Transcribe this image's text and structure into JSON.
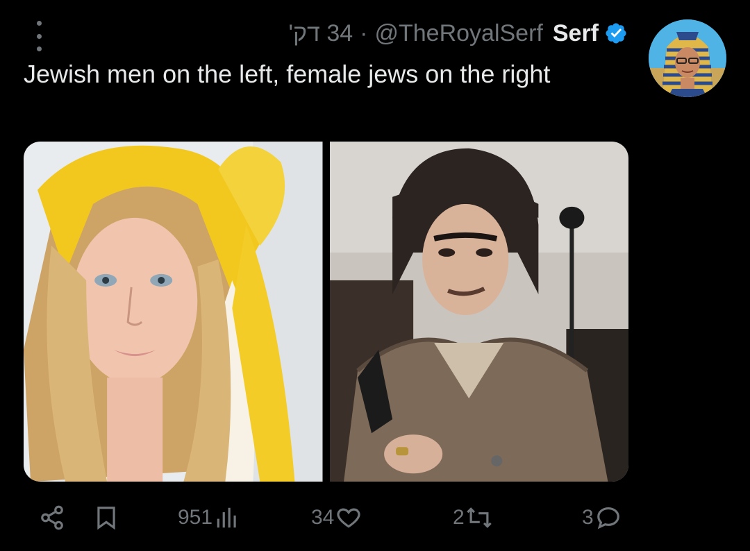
{
  "tweet": {
    "time": "34 דק'",
    "separator": "·",
    "handle": "@TheRoyalSerf",
    "display_name": "Serf",
    "verified": true,
    "text": "Jewish men on the left, female jews on the right",
    "avatar_icon": "pharaoh-avatar",
    "media_count": 2
  },
  "actions": {
    "views": "951",
    "likes": "34",
    "reposts": "2",
    "replies": "3"
  },
  "colors": {
    "background": "#000000",
    "text": "#e7e9ea",
    "muted": "#71767b",
    "verified_badge": "#1d9bf0"
  },
  "icons": [
    "more-vertical-icon",
    "verified-badge-icon",
    "share-icon",
    "bookmark-icon",
    "views-chart-icon",
    "heart-icon",
    "repost-icon",
    "reply-icon"
  ]
}
